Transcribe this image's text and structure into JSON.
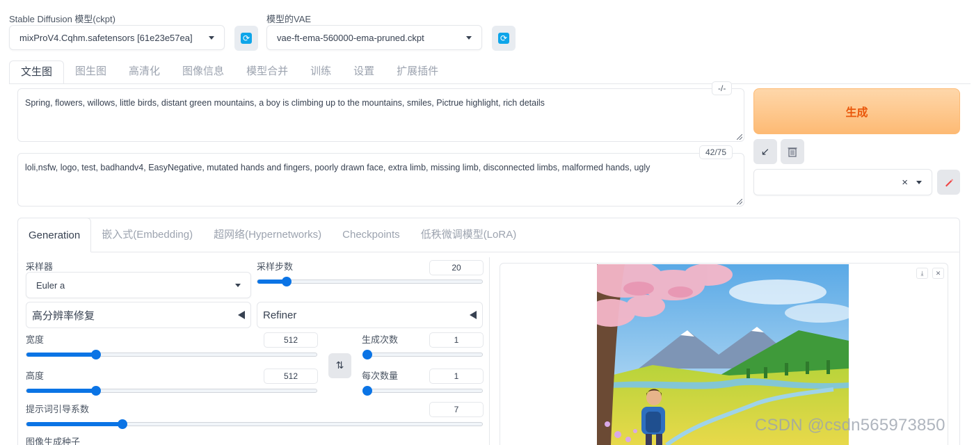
{
  "ckpt": {
    "label": "Stable Diffusion 模型(ckpt)",
    "value": "mixProV4.Cqhm.safetensors [61e23e57ea]"
  },
  "vae": {
    "label": "模型的VAE",
    "value": "vae-ft-ema-560000-ema-pruned.ckpt"
  },
  "tabs": [
    "文生图",
    "图生图",
    "高清化",
    "图像信息",
    "模型合并",
    "训练",
    "设置",
    "扩展插件"
  ],
  "prompt": {
    "text": "Spring, flowers, willows, little birds, distant green mountains, a boy is climbing up to the mountains, smiles, Pictrue highlight, rich details",
    "counter": "-/-"
  },
  "negative_prompt": {
    "text": "loli,nsfw, logo, test, badhandv4, EasyNegative, mutated hands and fingers, poorly drawn face, extra limb, missing limb, disconnected limbs, malformed hands, ugly",
    "counter": "42/75"
  },
  "generate_label": "生成",
  "style_select": {
    "clear": "×"
  },
  "subtabs": [
    "Generation",
    "嵌入式(Embedding)",
    "超网络(Hypernetworks)",
    "Checkpoints",
    "低秩微调模型(LoRA)"
  ],
  "sampler": {
    "label": "采样器",
    "value": "Euler a"
  },
  "steps": {
    "label": "采样步数",
    "value": "20",
    "fraction": 0.13
  },
  "hires": {
    "label": "高分辨率修复"
  },
  "refiner": {
    "label": "Refiner"
  },
  "width": {
    "label": "宽度",
    "value": "512",
    "fraction": 0.24
  },
  "height": {
    "label": "高度",
    "value": "512",
    "fraction": 0.24
  },
  "batch_count": {
    "label": "生成次数",
    "value": "1",
    "fraction": 0.0
  },
  "batch_size": {
    "label": "每次数量",
    "value": "1",
    "fraction": 0.0
  },
  "cfg": {
    "label": "提示词引导系数",
    "value": "7",
    "fraction": 0.21
  },
  "seed": {
    "label": "图像生成种子"
  },
  "swap_icon": "⇅",
  "watermark": "CSDN @csdn565973850",
  "colors": {
    "accent": "#0b74e5",
    "generate_bg": "#fdba74",
    "generate_text": "#ea580c",
    "refresh": "#0ea5e9"
  }
}
